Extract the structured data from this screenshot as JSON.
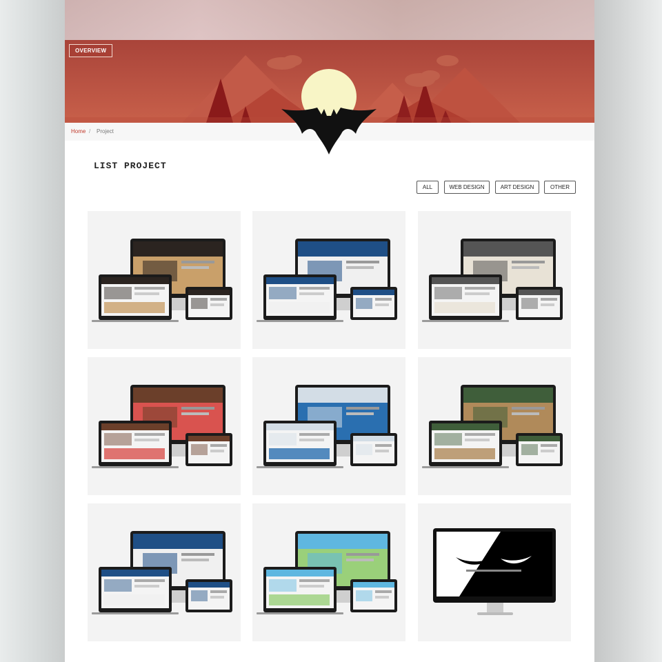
{
  "header": {
    "overview_label": "OVERVIEW"
  },
  "breadcrumb": {
    "home": "Home",
    "separator": "/",
    "current": "Project"
  },
  "main": {
    "title": "LIST PROJECT",
    "filters": [
      "ALL",
      "WEB DESIGN",
      "ART DESIGN",
      "OTHER"
    ]
  },
  "projects": [
    {
      "theme": "portrait-site",
      "screen_primary": "#2b2420",
      "screen_accent": "#c9a06a"
    },
    {
      "theme": "blue-portal",
      "screen_primary": "#1f4f86",
      "screen_accent": "#f0f0f0"
    },
    {
      "theme": "hotel-site",
      "screen_primary": "#555555",
      "screen_accent": "#e8e2d6"
    },
    {
      "theme": "station-site",
      "screen_primary": "#6b3f2a",
      "screen_accent": "#d9534f"
    },
    {
      "theme": "map-site",
      "screen_primary": "#d3dde6",
      "screen_accent": "#2a6fb0"
    },
    {
      "theme": "food-site",
      "screen_primary": "#3f5e3a",
      "screen_accent": "#b08a5a"
    },
    {
      "theme": "blue-portal-2",
      "screen_primary": "#1f4f86",
      "screen_accent": "#f0f0f0"
    },
    {
      "theme": "travel-site",
      "screen_primary": "#5fb7e0",
      "screen_accent": "#9ad07a"
    },
    {
      "theme": "black-white-art",
      "screen_primary": "#000000",
      "screen_accent": "#ffffff"
    }
  ],
  "colors": {
    "banner_sky": "#b9503e",
    "banner_mountain_dark": "#8e1e1e",
    "banner_sun": "#f8f5c6",
    "accent_link": "#c0392b"
  }
}
